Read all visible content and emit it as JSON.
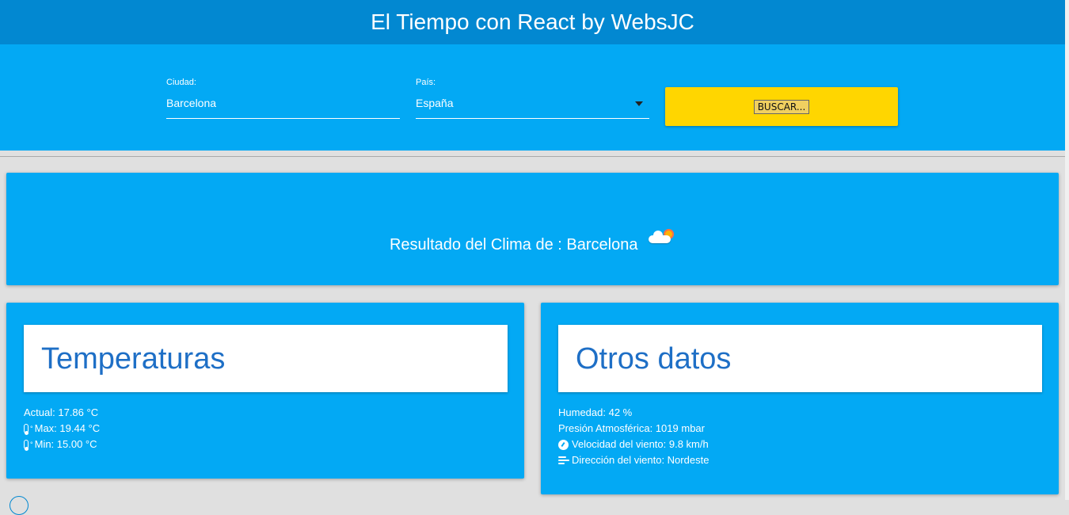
{
  "header": {
    "title": "El Tiempo con React by WebsJC"
  },
  "form": {
    "city_label": "Ciudad:",
    "city_value": "Barcelona",
    "country_label": "País:",
    "country_value": "España",
    "search_label": "BUSCAR..."
  },
  "result": {
    "title": "Resultado del Clima de : Barcelona",
    "weather_icon": "partly-cloudy-icon"
  },
  "temperatures": {
    "title": "Temperaturas",
    "current": "Actual: 17.86 °C",
    "max": "Max: 19.44 °C",
    "min": "Min: 15.00 °C"
  },
  "other": {
    "title": "Otros datos",
    "humidity": "Humedad: 42 %",
    "pressure": "Presión Atmosférica: 1019 mbar",
    "wind_speed": "Velocidad del viento: 9.8 km/h",
    "wind_direction": "Dirección del viento: Nordeste"
  },
  "colors": {
    "appbar": "#0288d1",
    "primary": "#03a9f4",
    "button": "#ffd600",
    "title_text": "#1e6fc6"
  }
}
